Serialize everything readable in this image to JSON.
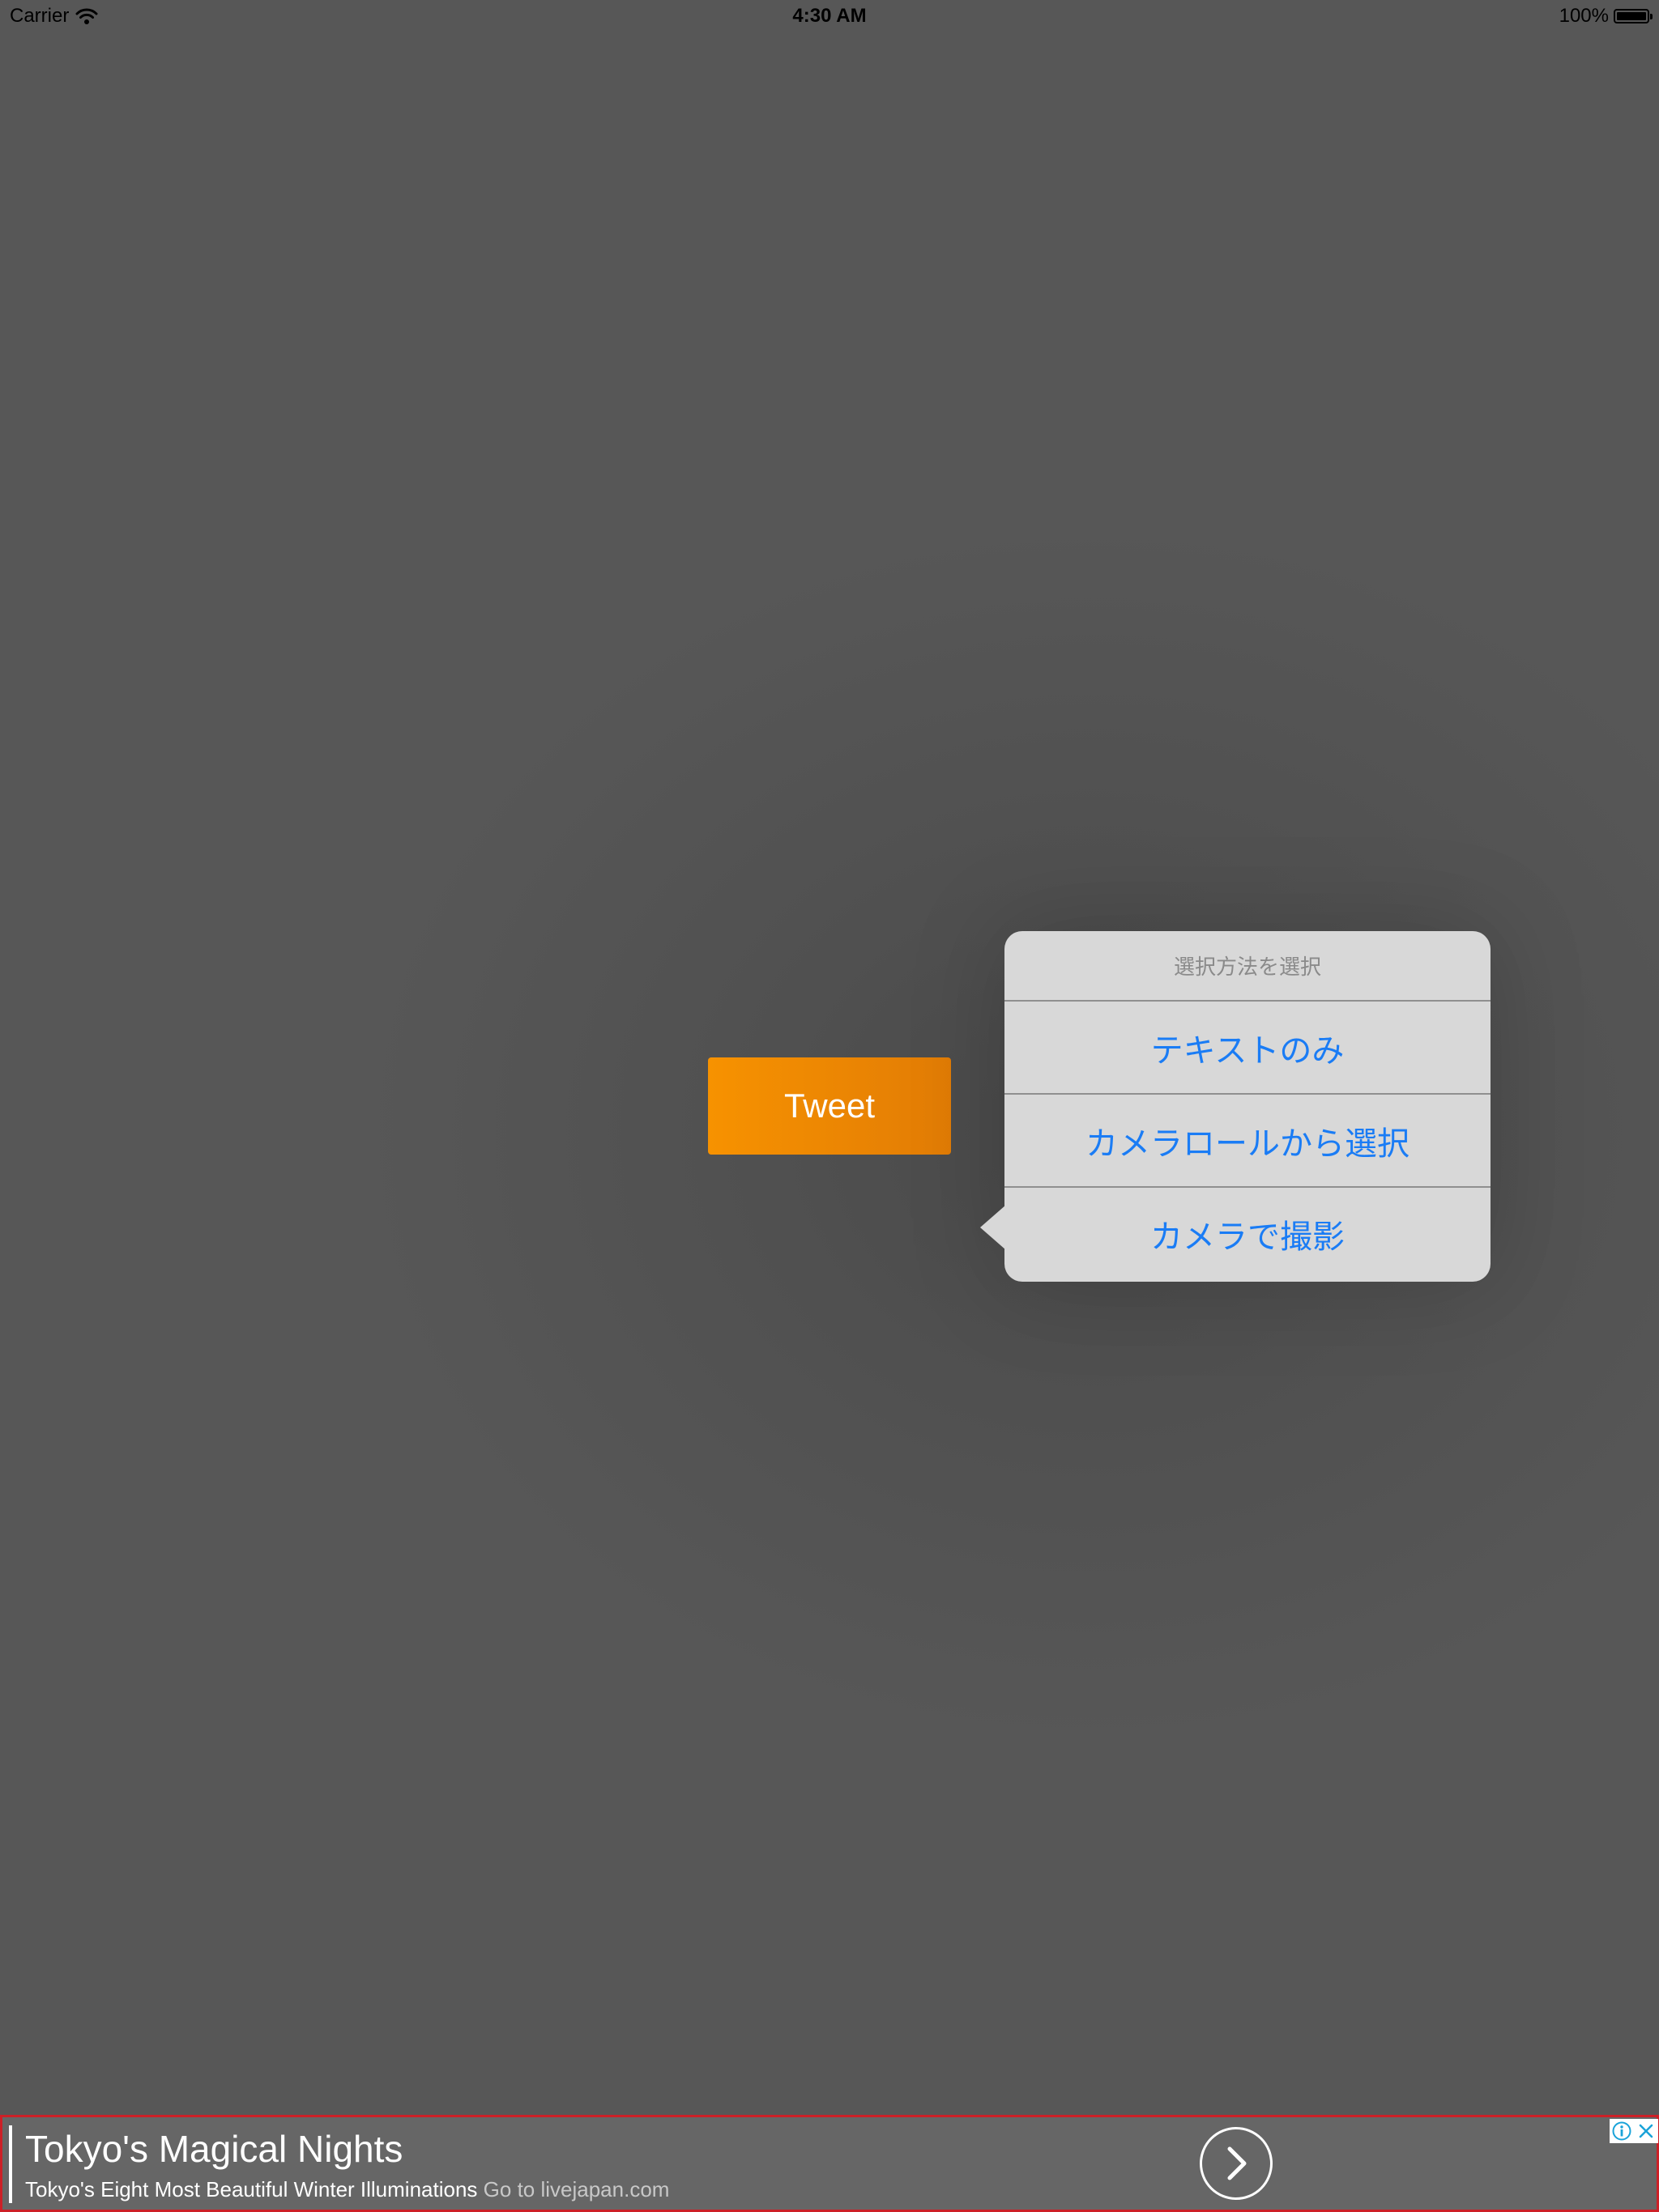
{
  "status_bar": {
    "carrier": "Carrier",
    "time": "4:30 AM",
    "battery": "100%"
  },
  "tweet_button": {
    "label": "Tweet",
    "color": "#f79200"
  },
  "action_sheet": {
    "title": "選択方法を選択",
    "options": [
      {
        "label": "テキストのみ"
      },
      {
        "label": "カメラロールから選択"
      },
      {
        "label": "カメラで撮影"
      }
    ],
    "option_color": "#1a7cf5"
  },
  "ad": {
    "headline": "Tokyo's Magical Nights",
    "description": "Tokyo's Eight Most Beautiful Winter Illuminations",
    "source": "Go to livejapan.com",
    "border_color": "#cc2027",
    "icons": {
      "cta": "chevron-right-icon",
      "info": "info-icon",
      "close": "close-icon"
    }
  }
}
